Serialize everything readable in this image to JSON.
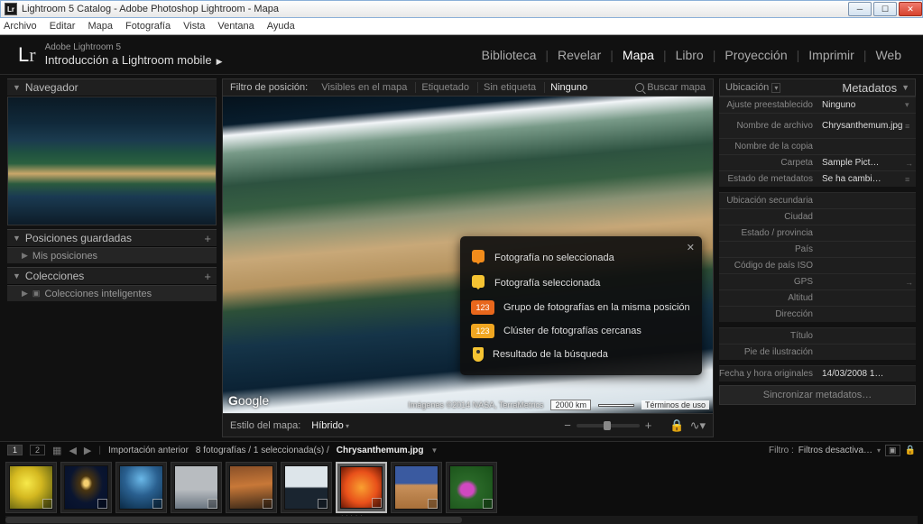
{
  "window": {
    "title": "Lightroom 5 Catalog - Adobe Photoshop Lightroom - Mapa",
    "app_icon": "Lr"
  },
  "menu": [
    "Archivo",
    "Editar",
    "Mapa",
    "Fotografía",
    "Vista",
    "Ventana",
    "Ayuda"
  ],
  "identity": {
    "line1": "Adobe Lightroom 5",
    "line2": "Introducción a Lightroom mobile"
  },
  "modules": [
    "Biblioteca",
    "Revelar",
    "Mapa",
    "Libro",
    "Proyección",
    "Imprimir",
    "Web"
  ],
  "modules_active": "Mapa",
  "left": {
    "navigator": "Navegador",
    "saved": "Posiciones guardadas",
    "saved_item": "Mis posiciones",
    "collections": "Colecciones",
    "collections_item": "Colecciones inteligentes"
  },
  "filter": {
    "label": "Filtro de posición:",
    "visible": "Visibles en el mapa",
    "tagged": "Etiquetado",
    "untagged": "Sin etiqueta",
    "none": "Ninguno",
    "search": "Buscar mapa"
  },
  "map": {
    "google": "Google",
    "credits": "Imágenes ©2014 NASA, TerraMetrics",
    "scale": "2000 km",
    "terms": "Términos de uso"
  },
  "legend": {
    "r1": "Fotografía no seleccionada",
    "r2": "Fotografía seleccionada",
    "r3": "Grupo de fotografías en la misma posición",
    "r4": "Clúster de fotografías cercanas",
    "r5": "Resultado de la búsqueda",
    "badge": "123"
  },
  "mapbar": {
    "style_label": "Estilo del mapa:",
    "style": "Híbrido"
  },
  "meta": {
    "loc": "Ubicación",
    "title": "Metadatos",
    "preset_l": "Ajuste preestablecido",
    "preset_v": "Ninguno",
    "fname_l": "Nombre de archivo",
    "fname_v": "Chrysanthemum.jpg",
    "cname_l": "Nombre de la copia",
    "cname_v": "",
    "folder_l": "Carpeta",
    "folder_v": "Sample Pict…",
    "mstate_l": "Estado de metadatos",
    "mstate_v": "Se ha cambi…",
    "subloc_l": "Ubicación secundaria",
    "city_l": "Ciudad",
    "state_l": "Estado / provincia",
    "country_l": "País",
    "iso_l": "Código de país ISO",
    "gps_l": "GPS",
    "alt_l": "Altitud",
    "dir_l": "Dirección",
    "title_l": "Título",
    "caption_l": "Pie de ilustración",
    "date_l": "Fecha y hora originales",
    "date_v": "14/03/2008 1…",
    "sync": "Sincronizar metadatos…"
  },
  "filmstrip": {
    "p1": "1",
    "p2": "2",
    "nav": "Importación anterior",
    "count": "8 fotografías / 1 seleccionada(s) /",
    "selected": "Chrysanthemum.jpg",
    "filter_l": "Filtro :",
    "filter_v": "Filtros desactiva…"
  }
}
